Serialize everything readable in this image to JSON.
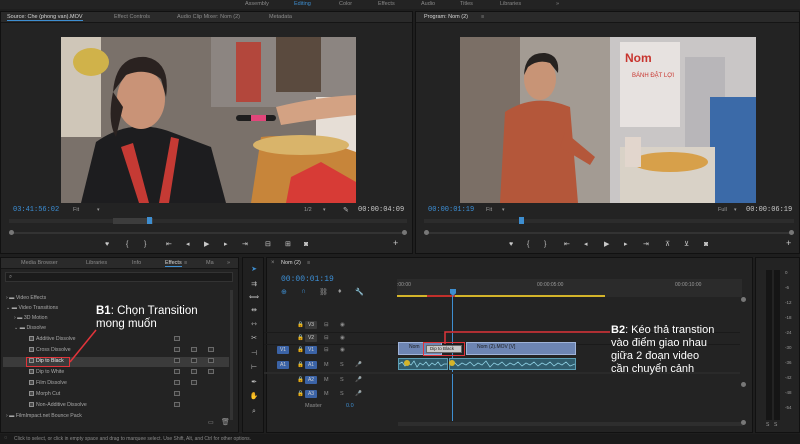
{
  "workspaces": [
    "Assembly",
    "Editing",
    "Color",
    "Effects",
    "Audio",
    "Titles",
    "Libraries"
  ],
  "workspace_more": "»",
  "source": {
    "tabs": [
      "Source: Che (phong van).MOV",
      "Effect Controls",
      "Audio Clip Mixer: Nom (2)",
      "Metadata"
    ],
    "timecode": "03:41:56:02",
    "fit": "Fit",
    "resolution": "1/2",
    "duration": "00:00:04:09"
  },
  "program": {
    "tab": "Program: Nom (2)",
    "timecode": "00:00:01:19",
    "fit": "Fit",
    "resolution": "Full",
    "duration": "00:00:06:19"
  },
  "effects": {
    "tabs": [
      "Media Browser",
      "Libraries",
      "Info",
      "Effects",
      "Ma"
    ],
    "tree": [
      {
        "label": "Video Effects",
        "indent": 0,
        "type": "folder"
      },
      {
        "label": "Video Transitions",
        "indent": 0,
        "type": "folder"
      },
      {
        "label": "3D Motion",
        "indent": 1,
        "type": "folder"
      },
      {
        "label": "Dissolve",
        "indent": 1,
        "type": "folder"
      },
      {
        "label": "Additive Dissolve",
        "indent": 2,
        "type": "fx"
      },
      {
        "label": "Cross Dissolve",
        "indent": 2,
        "type": "fx"
      },
      {
        "label": "Dip to Black",
        "indent": 2,
        "type": "fx"
      },
      {
        "label": "Dip to White",
        "indent": 2,
        "type": "fx"
      },
      {
        "label": "Film Dissolve",
        "indent": 2,
        "type": "fx"
      },
      {
        "label": "Morph Cut",
        "indent": 2,
        "type": "fx"
      },
      {
        "label": "Non-Additive Dissolve",
        "indent": 2,
        "type": "fx"
      },
      {
        "label": "FilmImpact.net Bounce Pack",
        "indent": 0,
        "type": "folder"
      }
    ]
  },
  "timeline": {
    "tab": "Nom (2)",
    "timecode": "00:00:01:19",
    "ruler": [
      ":00:00",
      "00:00:05:00",
      "00:00:10:00"
    ],
    "tracks": {
      "video": [
        "V3",
        "V2",
        "V1"
      ],
      "audio": [
        "A1",
        "A2",
        "A3"
      ],
      "source_patch": [
        "V1",
        "A1"
      ],
      "master": "Master",
      "master_value": "0.0"
    },
    "clips": {
      "v1_a": "Nom",
      "v1_b": "Nom (2).MOV [V]",
      "transition": "Dip to Black"
    }
  },
  "meter_labels": [
    "0",
    "-6",
    "-12",
    "-18",
    "-24",
    "-30",
    "-36",
    "-42",
    "-48",
    "-54"
  ],
  "meter_bottom": [
    "S",
    "S"
  ],
  "status": "Click to select, or click in empty space and drag to marquee select. Use Shift, Alt, and Ctrl for other options.",
  "annotations": {
    "b1_tag": "B1",
    "b1_line1": ": Chọn Transition",
    "b1_line2": "mong muốn",
    "b2_tag": "B2",
    "b2_line1": ": Kéo thả transtion",
    "b2_line2": "vào điểm giao nhau",
    "b2_line3": "giữa 2 đoạn video",
    "b2_line4": "cần chuyển cảnh"
  },
  "colors": {
    "accent": "#3e8ed0",
    "highlight": "#e0343a",
    "clip_video": "#6d85b3",
    "clip_audio": "#305d6e"
  }
}
